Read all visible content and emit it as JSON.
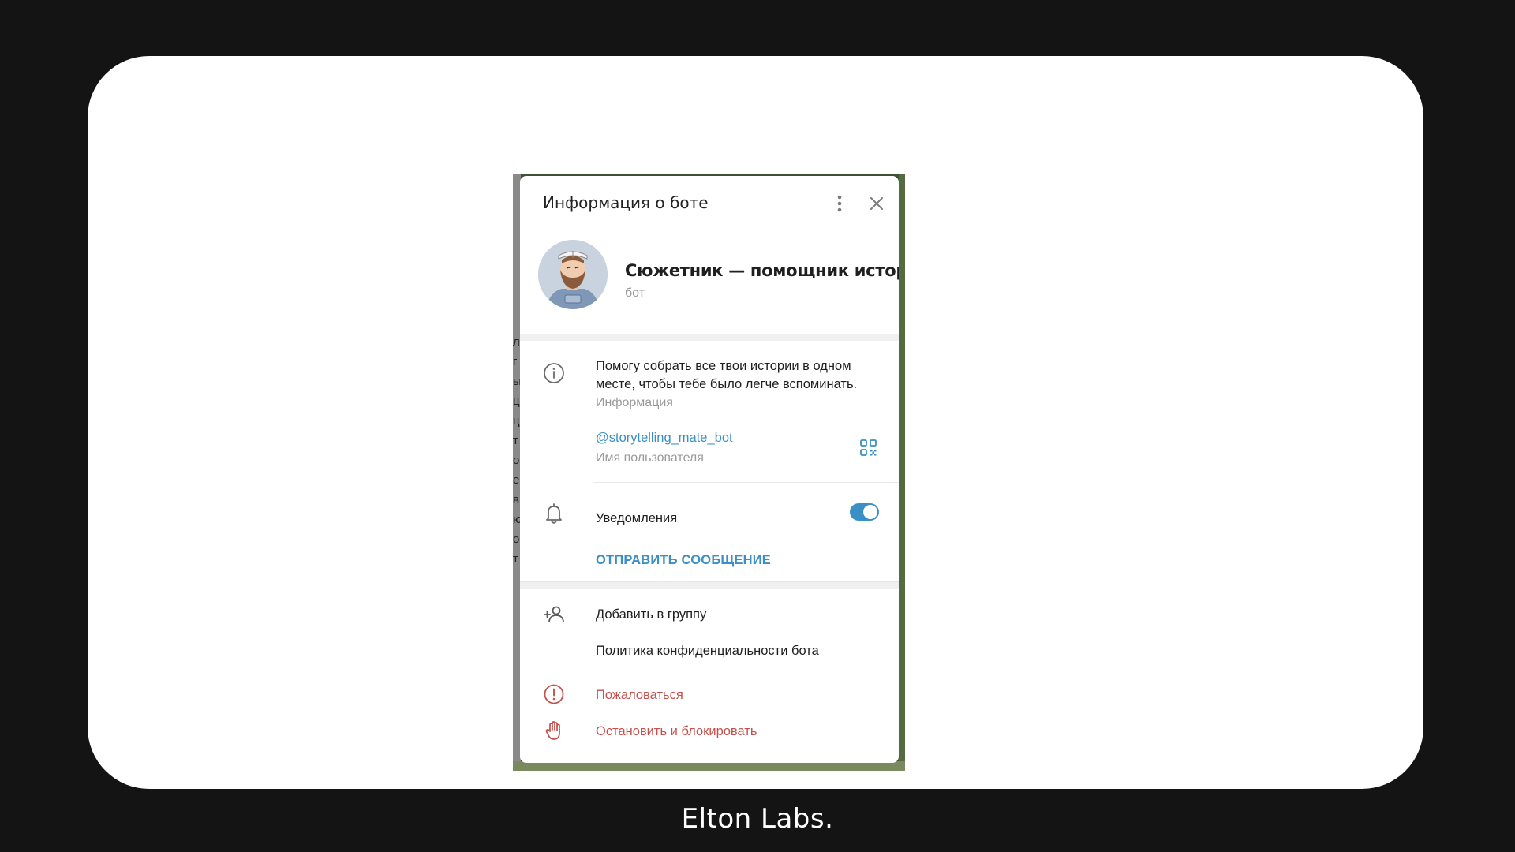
{
  "footer": {
    "brand": "Elton Labs."
  },
  "dialog": {
    "title": "Информация о боте",
    "more_icon": "more-vertical-icon",
    "close_icon": "close-icon"
  },
  "profile": {
    "name": "Сюжетник — помощник истор...",
    "subtitle": "бот",
    "avatar": "bearded-man-reading-avatar"
  },
  "info": {
    "description": "Помогу собрать все твои истории в одном месте, чтобы тебе было легче вспоминать.",
    "description_label": "Информация",
    "username": "@storytelling_mate_bot",
    "username_label": "Имя пользователя",
    "notifications_label": "Уведомления",
    "notifications_enabled": true,
    "send_message_label": "ОТПРАВИТЬ СООБЩЕНИЕ"
  },
  "actions": {
    "add_to_group": "Добавить в группу",
    "privacy_policy": "Политика конфиденциальности бота",
    "report": "Пожаловаться",
    "stop_block": "Остановить и блокировать"
  },
  "background": {
    "left_edge_letters": [
      "л",
      "г",
      "ы",
      "ц",
      "ц",
      "т",
      "о",
      "е",
      "в",
      "ю",
      "о",
      "т"
    ]
  },
  "colors": {
    "accent": "#3a8fc5",
    "danger": "#c5504c",
    "page_bg": "#141414",
    "card_bg": "#ffffff"
  }
}
